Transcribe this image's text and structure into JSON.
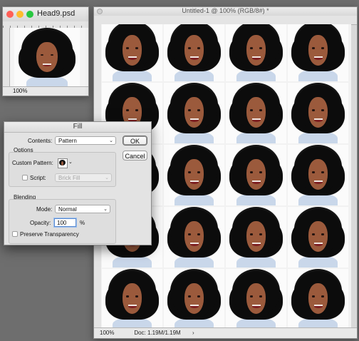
{
  "small_window": {
    "title": "Head9.psd",
    "zoom": "100%",
    "image": "portrait-woman-curly-hair"
  },
  "main_window": {
    "title": "Untitled-1 @ 100% (RGB/8#) *",
    "zoom": "100%",
    "doc_info": "Doc: 1.19M/1.19M",
    "pattern": "portrait-tile-grid"
  },
  "fill_dialog": {
    "title": "Fill",
    "contents_label": "Contents:",
    "contents_value": "Pattern",
    "options_label": "Options",
    "custom_pattern_label": "Custom Pattern:",
    "script_label": "Script:",
    "script_value": "Brick Fill",
    "blending_label": "Blending",
    "mode_label": "Mode:",
    "mode_value": "Normal",
    "opacity_label": "Opacity:",
    "opacity_value": "100",
    "opacity_unit": "%",
    "preserve_label": "Preserve Transparency",
    "ok_label": "OK",
    "cancel_label": "Cancel"
  },
  "colors": {
    "background": "#6e6e6e",
    "window": "#d9d9d9",
    "close": "#ff5f57",
    "minimize": "#febc2e",
    "zoom": "#28c840"
  }
}
